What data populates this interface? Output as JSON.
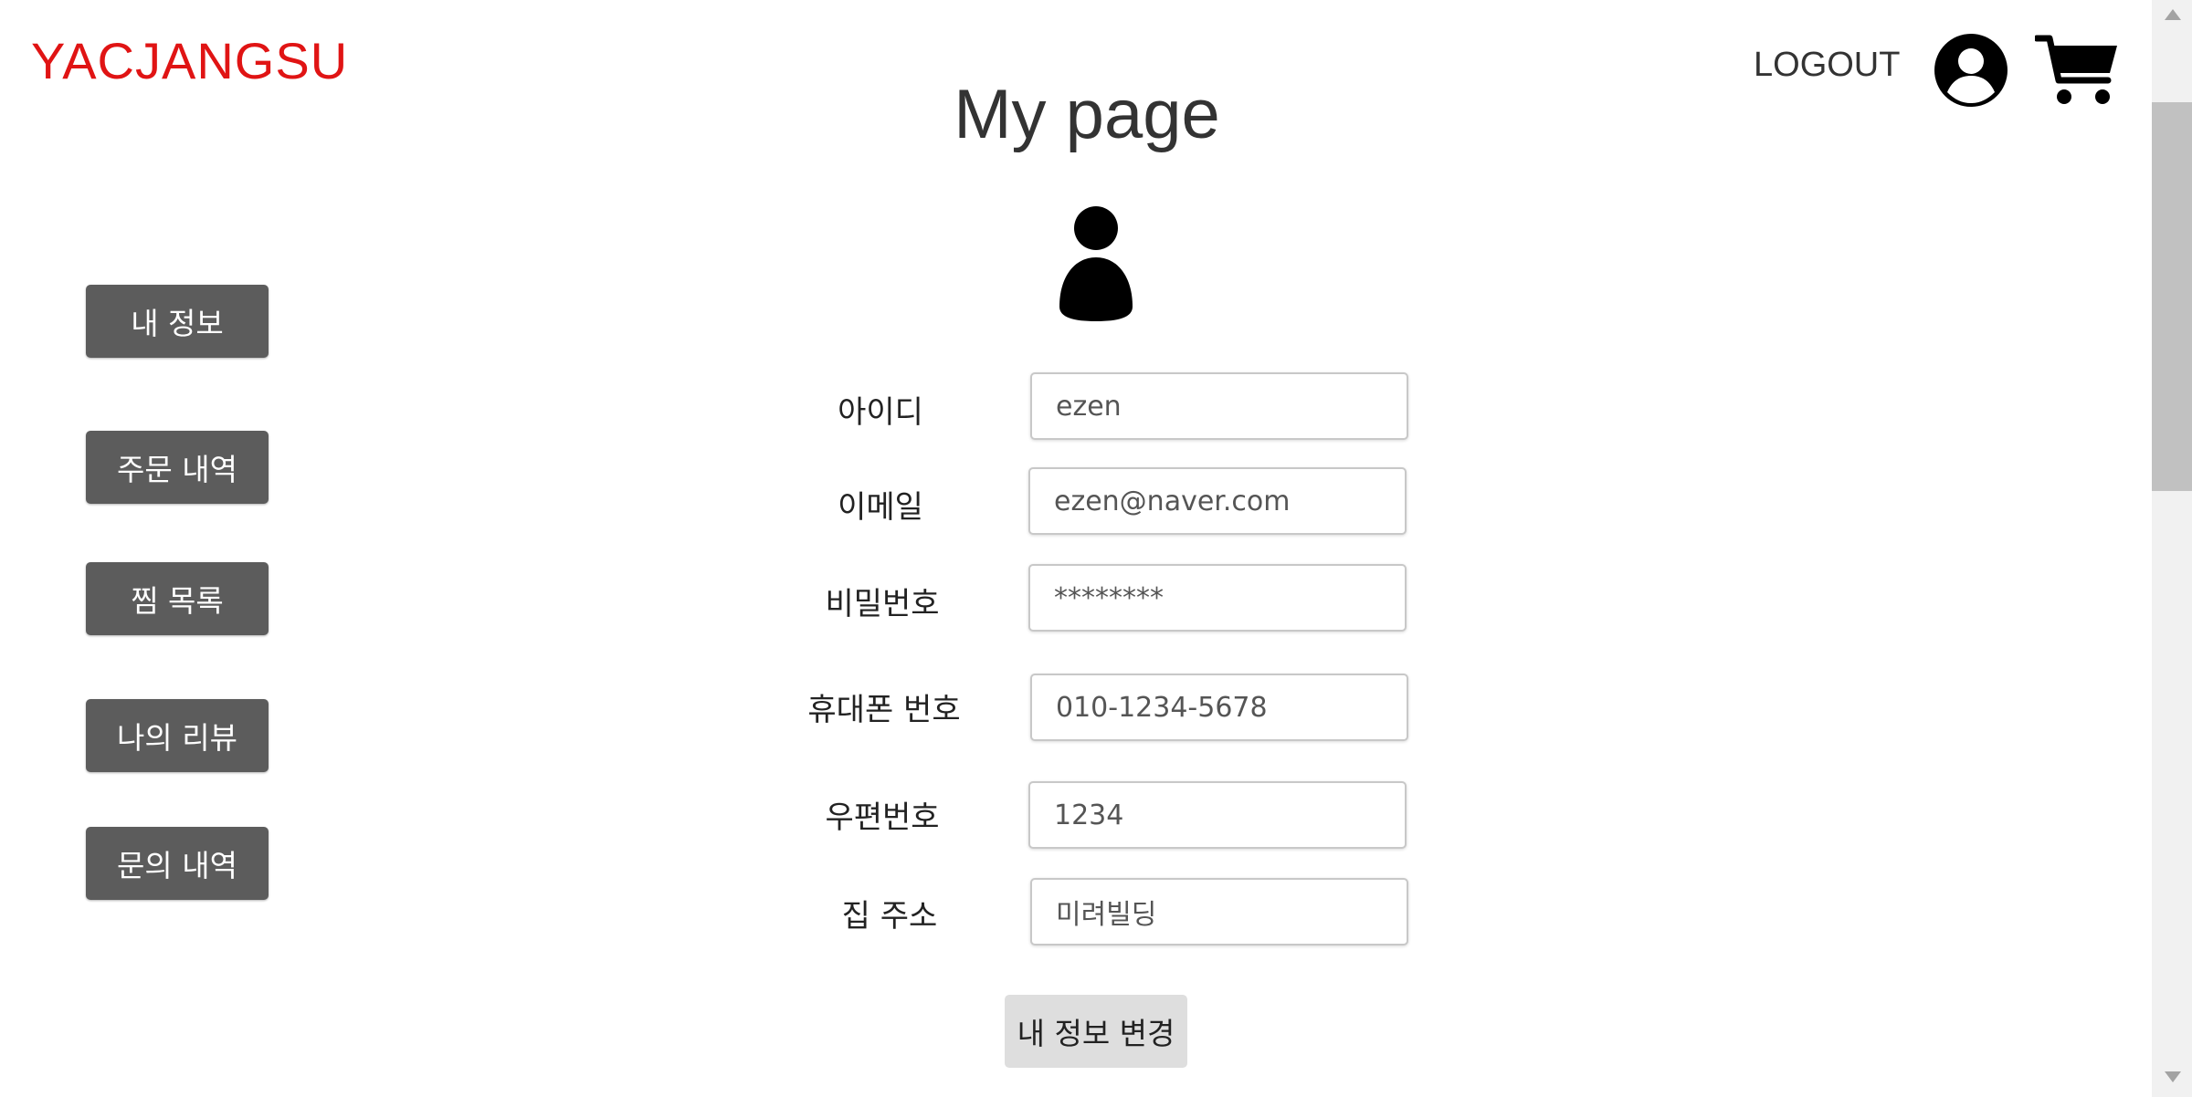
{
  "header": {
    "logo": "YACJANGSU",
    "logout_label": "LOGOUT",
    "icons": [
      "user-circle-icon",
      "cart-icon"
    ],
    "logo_color": "#e01414"
  },
  "page_title": "My page",
  "sidebar": {
    "items": [
      {
        "label": "내 정보"
      },
      {
        "label": "주문 내역"
      },
      {
        "label": "찜 목록"
      },
      {
        "label": "나의 리뷰"
      },
      {
        "label": "문의 내역"
      }
    ]
  },
  "form": {
    "fields": [
      {
        "label": "아이디",
        "value": "ezen"
      },
      {
        "label": "이메일",
        "value": "ezen@naver.com"
      },
      {
        "label": "비밀번호",
        "value": "********"
      },
      {
        "label": "휴대폰 번호",
        "value": "010-1234-5678"
      },
      {
        "label": "우편번호",
        "value": "1234"
      },
      {
        "label": "집 주소",
        "value": "미려빌딩"
      }
    ],
    "submit_label": "내 정보 변경"
  },
  "colors": {
    "sidebar_button": "#5c5c5c",
    "submit_button": "#dedede"
  }
}
